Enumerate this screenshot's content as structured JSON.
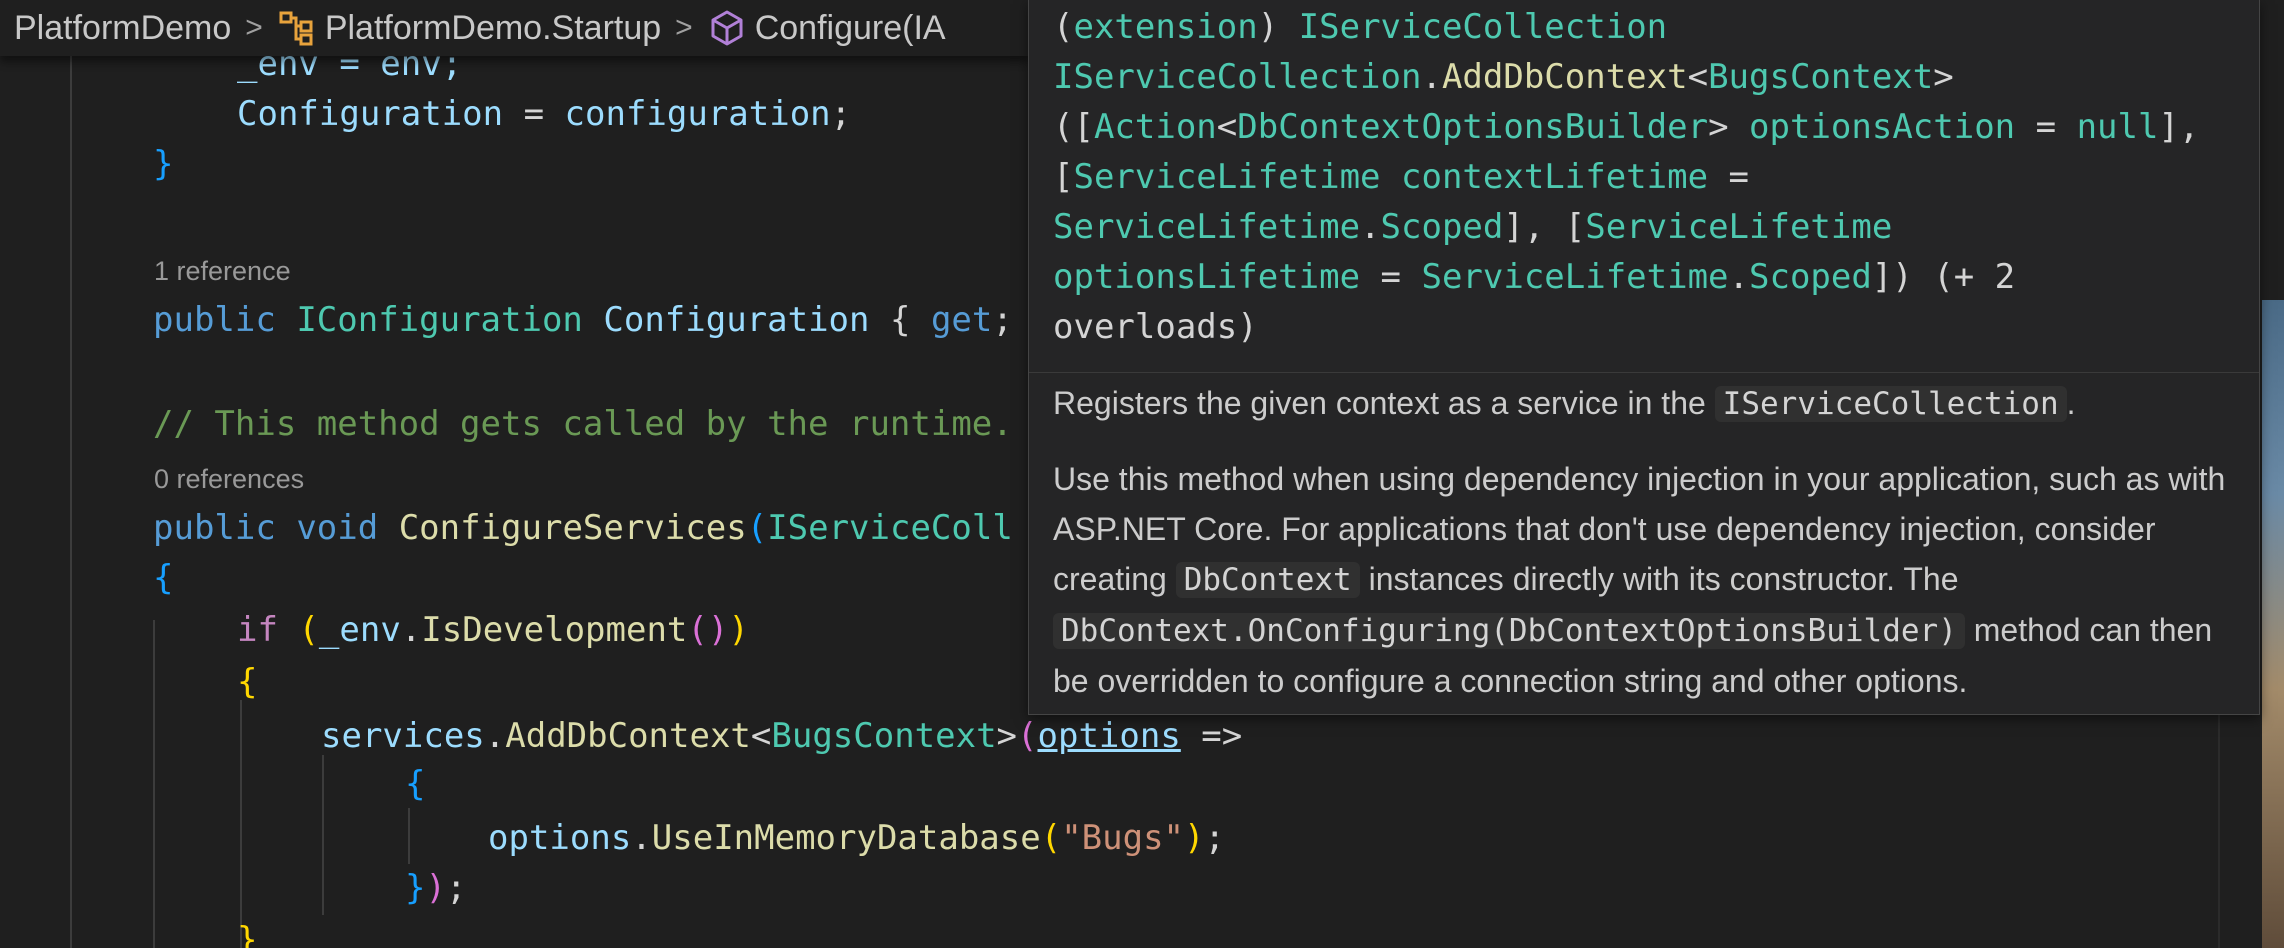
{
  "breadcrumb": {
    "items": [
      {
        "label": "PlatformDemo",
        "icon": "none"
      },
      {
        "label": "PlatformDemo.Startup",
        "icon": "class-icon"
      },
      {
        "label": "Configure(IA",
        "icon": "method-icon"
      }
    ],
    "separator": ">"
  },
  "code": {
    "line_env": "_env = env;",
    "line_config_lhs": "Configuration",
    "line_config_eq": " = ",
    "line_config_rhs": "configuration",
    "line_config_end": ";",
    "close_brace": "}",
    "codelens_1": "1 reference",
    "prop_kw": "public",
    "prop_type": "IConfiguration",
    "prop_name": "Configuration",
    "prop_rest_open": "{",
    "prop_get": "get",
    "prop_semicolon": ";",
    "comment": "// This method gets called by the runtime.",
    "codelens_2": "0 references",
    "method_kw": "public",
    "method_void": "void",
    "method_name": "ConfigureServices",
    "method_paren": "(",
    "method_param_type": "IServiceColl",
    "open_brace": "{",
    "if_kw": "if",
    "if_open": "(",
    "if_env": "_env",
    "if_dot": ".",
    "if_method": "IsDevelopment",
    "if_inner": "()",
    "if_close": ")",
    "if_brace": "{",
    "svc_obj": "services",
    "svc_dot": ".",
    "svc_method": "AddDbContext",
    "svc_lt": "<",
    "svc_type": "BugsContext",
    "svc_gt": ">",
    "svc_paren": "(",
    "svc_options": "options",
    "svc_arrow": " =>",
    "lambda_open": "{",
    "opt_obj": "options",
    "opt_dot": ".",
    "opt_method": "UseInMemoryDatabase",
    "opt_paren_open": "(",
    "opt_string": "\"Bugs\"",
    "opt_paren_close": ")",
    "opt_semi": ";",
    "lambda_close_brace": "}",
    "lambda_close_paren": ")",
    "lambda_semi": ";",
    "bottom_brace": "}"
  },
  "hover": {
    "signature": {
      "t1": "(",
      "t2": "extension",
      "t3": ") ",
      "t4": "IServiceCollection",
      "t5": "IServiceCollection",
      "t6": ".",
      "t7": "AddDbContext",
      "t8": "<",
      "t9": "BugsContext",
      "t10": ">",
      "t11": "([",
      "t12": "Action",
      "t13": "<",
      "t14": "DbContextOptionsBuilder",
      "t15": "> ",
      "t16": "optionsAction",
      "t17": " = ",
      "t18": "null",
      "t19": "],",
      "t20": "[",
      "t21": "ServiceLifetime",
      "t22": " ",
      "t23": "contextLifetime",
      "t24": " =",
      "t25": "ServiceLifetime",
      "t26": ".",
      "t27": "Scoped",
      "t28": "], [",
      "t29": "ServiceLifetime",
      "t30": "optionsLifetime",
      "t31": " = ",
      "t32": "ServiceLifetime",
      "t33": ".",
      "t34": "Scoped",
      "t35": "]) (+ 2",
      "t36": "overloads)"
    },
    "desc1_pre": "Registers the given context as a service in the",
    "desc1_code": "IServiceCollection",
    "desc1_post": ".",
    "desc2_a": "Use this method when using dependency injection in your application, such as with ASP.NET Core. For applications that don't use dependency injection, consider creating",
    "desc2_code1": "DbContext",
    "desc2_b": "instances directly with its constructor. The",
    "desc2_code2": "DbContext.OnConfiguring(DbContextOptionsBuilder)",
    "desc2_c": "method can then be overridden to configure a connection string and other options."
  }
}
